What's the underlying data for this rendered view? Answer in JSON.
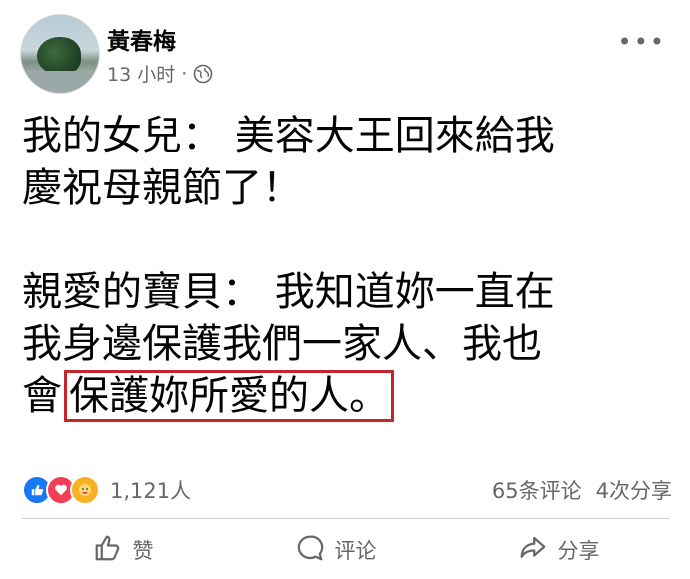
{
  "post": {
    "author_name": "黃春梅",
    "time_ago": "13 小时",
    "dot": "·",
    "lines": [
      "我的女兒： 美容大王回來給我",
      "慶祝母親節了！",
      "",
      "親愛的寶貝： 我知道妳一直在",
      "我身邊保護我們一家人、我也"
    ],
    "last_line_prefix": "會",
    "last_line_highlight": "保護妳所愛的人。"
  },
  "reactions": {
    "count": "1,121人",
    "icons": [
      "like-icon",
      "love-icon",
      "care-icon"
    ]
  },
  "stats": {
    "comments": "65条评论",
    "shares": "4次分享"
  },
  "actions": {
    "like_label": "赞",
    "comment_label": "评论",
    "share_label": "分享"
  },
  "colors": {
    "highlight_border": "#c1272d",
    "meta_text": "#65676b",
    "like_blue": "#1877f2",
    "love_red": "#f33e58",
    "care_yellow": "#f7b125"
  }
}
